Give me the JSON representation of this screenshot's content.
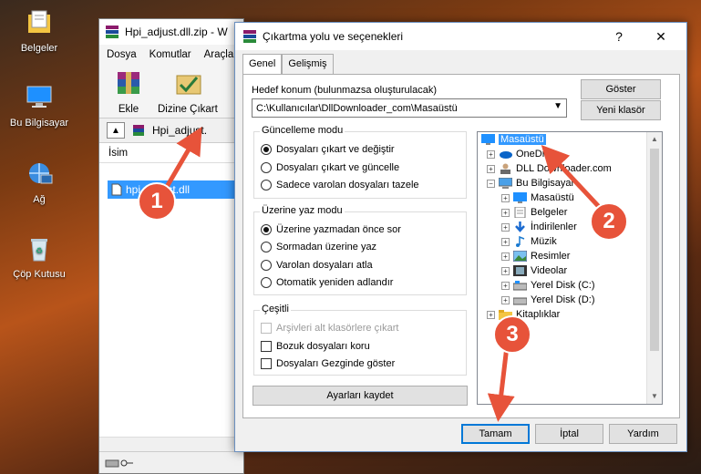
{
  "desktop": {
    "icons": [
      {
        "label": "Belgeler",
        "icon": "documents-folder-icon"
      },
      {
        "label": "Bu Bilgisayar",
        "icon": "computer-icon"
      },
      {
        "label": "Ağ",
        "icon": "network-icon"
      },
      {
        "label": "Çöp Kutusu",
        "icon": "recycle-bin-icon"
      }
    ]
  },
  "winrar": {
    "title": "Hpi_adjust.dll.zip - W",
    "menu": [
      "Dosya",
      "Komutlar",
      "Araçla"
    ],
    "tools": [
      "Ekle",
      "Dizine Çıkart"
    ],
    "address": "Hpi_adjust.",
    "list_header": "İsim",
    "file_row": "hpi_adjust.dll"
  },
  "dialog": {
    "title": "Çıkartma yolu ve seçenekleri",
    "title_help": "?",
    "title_close": "✕",
    "tabs": [
      "Genel",
      "Gelişmiş"
    ],
    "dest_label": "Hedef konum (bulunmazsa oluşturulacak)",
    "dest_value": "C:\\Kullanıcılar\\DllDownloader_com\\Masaüstü",
    "show_button": "Göster",
    "new_folder_button": "Yeni klasör",
    "update_mode": {
      "title": "Güncelleme modu",
      "options": [
        "Dosyaları çıkart ve değiştir",
        "Dosyaları çıkart ve güncelle",
        "Sadece varolan dosyaları tazele"
      ],
      "selected": 0
    },
    "overwrite_mode": {
      "title": "Üzerine yaz modu",
      "options": [
        "Üzerine yazmadan önce sor",
        "Sormadan üzerine yaz",
        "Varolan dosyaları atla",
        "Otomatik yeniden adlandır"
      ],
      "selected": 0
    },
    "misc": {
      "title": "Çeşitli",
      "options": [
        "Arşivleri alt klasörlere çıkart",
        "Bozuk dosyaları koru",
        "Dosyaları Gezginde göster"
      ],
      "disabled": [
        true,
        false,
        false
      ]
    },
    "save_settings_button": "Ayarları kaydet",
    "tree": [
      {
        "label": "Masaüstü",
        "icon": "desktop-icon",
        "selected": true
      },
      {
        "label": "OneDrive",
        "icon": "onedrive-icon"
      },
      {
        "label": "DLL Downloader.com",
        "icon": "user-icon"
      },
      {
        "label": "Bu Bilgisayar",
        "icon": "computer-icon"
      },
      {
        "label": "Masaüstü",
        "icon": "desktop-icon"
      },
      {
        "label": "Belgeler",
        "icon": "documents-icon"
      },
      {
        "label": "İndirilenler",
        "icon": "downloads-icon"
      },
      {
        "label": "Müzik",
        "icon": "music-icon"
      },
      {
        "label": "Resimler",
        "icon": "pictures-icon"
      },
      {
        "label": "Videolar",
        "icon": "videos-icon"
      },
      {
        "label": "Yerel Disk (C:)",
        "icon": "drive-icon"
      },
      {
        "label": "Yerel Disk (D:)",
        "icon": "drive-icon"
      },
      {
        "label": "Kitaplıklar",
        "icon": "libraries-icon"
      }
    ],
    "ok_button": "Tamam",
    "cancel_button": "İptal",
    "help_button": "Yardım"
  },
  "callouts": [
    "1",
    "2",
    "3"
  ],
  "colors": {
    "selection": "#3399ff",
    "callout": "#e7533a",
    "accent": "#0078d7"
  }
}
